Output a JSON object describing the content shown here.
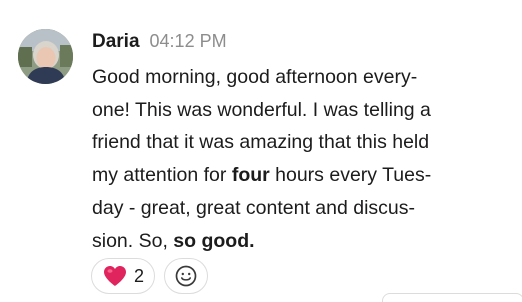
{
  "message": {
    "author": "Daria",
    "timestamp": "04:12 PM",
    "avatar_icon": "user-avatar-photo",
    "lines": [
      {
        "text": "Good morning, good afternoon every-"
      },
      {
        "text": "one! This was wonderful. I was telling a"
      },
      {
        "text": "friend that it was amazing that this held"
      },
      {
        "pre": "my attention for ",
        "bold": "four",
        "post": " hours every Tues-"
      },
      {
        "text": "day - great, great content and discus-"
      },
      {
        "pre": "sion. So, ",
        "bold": "so good.",
        "post": ""
      }
    ]
  },
  "reactions": {
    "heart": {
      "icon": "heart-emoji",
      "count": "2",
      "color": "#e0245e"
    },
    "add": {
      "icon": "add-reaction-smiley-icon"
    }
  }
}
